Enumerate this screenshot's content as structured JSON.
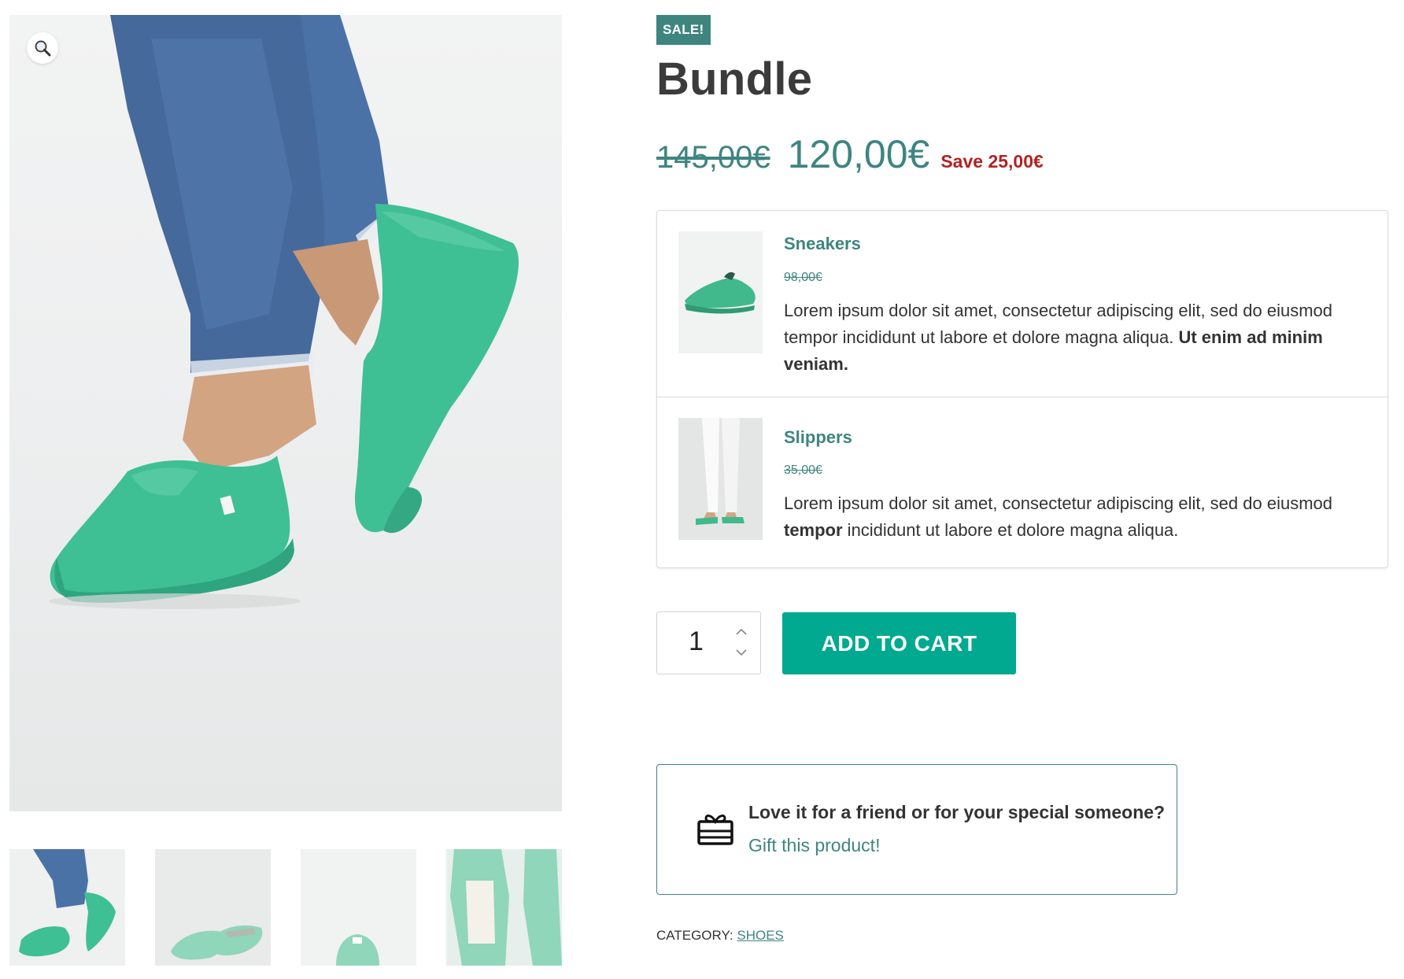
{
  "product": {
    "sale_badge": "SALE!",
    "title": "Bundle",
    "old_price": "145,00€",
    "new_price": "120,00€",
    "save_label": "Save 25,00€"
  },
  "gallery": {
    "zoom_icon": "magnifier-icon",
    "thumbnails": [
      {
        "name": "thumbnail-1"
      },
      {
        "name": "thumbnail-2"
      },
      {
        "name": "thumbnail-3"
      },
      {
        "name": "thumbnail-4"
      }
    ]
  },
  "bundle": {
    "items": [
      {
        "name": "Sneakers",
        "price": "98,00€",
        "desc_plain": "Lorem ipsum dolor sit amet, consectetur adipiscing elit, sed do eiusmod tempor incididunt ut labore et dolore magna aliqua. ",
        "desc_bold": "Ut enim ad minim veniam."
      },
      {
        "name": "Slippers",
        "price": "35,00€",
        "desc_plain_1": "Lorem ipsum dolor sit amet, consectetur adipiscing elit, sed do eiusmod ",
        "desc_bold": "tempor",
        "desc_plain_2": " incididunt ut labore et dolore magna aliqua."
      }
    ]
  },
  "cart": {
    "quantity": "1",
    "button_label": "ADD TO CART"
  },
  "gift": {
    "icon": "gift-card-icon",
    "question": "Love it for a friend or for your special someone?",
    "link": "Gift this product!"
  },
  "meta": {
    "category_label": "CATEGORY:",
    "category_value": "SHOES"
  },
  "colors": {
    "accent": "#3e8580",
    "button": "#00a98f",
    "sale_text": "#b22222",
    "shoe": "#3fbf94"
  }
}
